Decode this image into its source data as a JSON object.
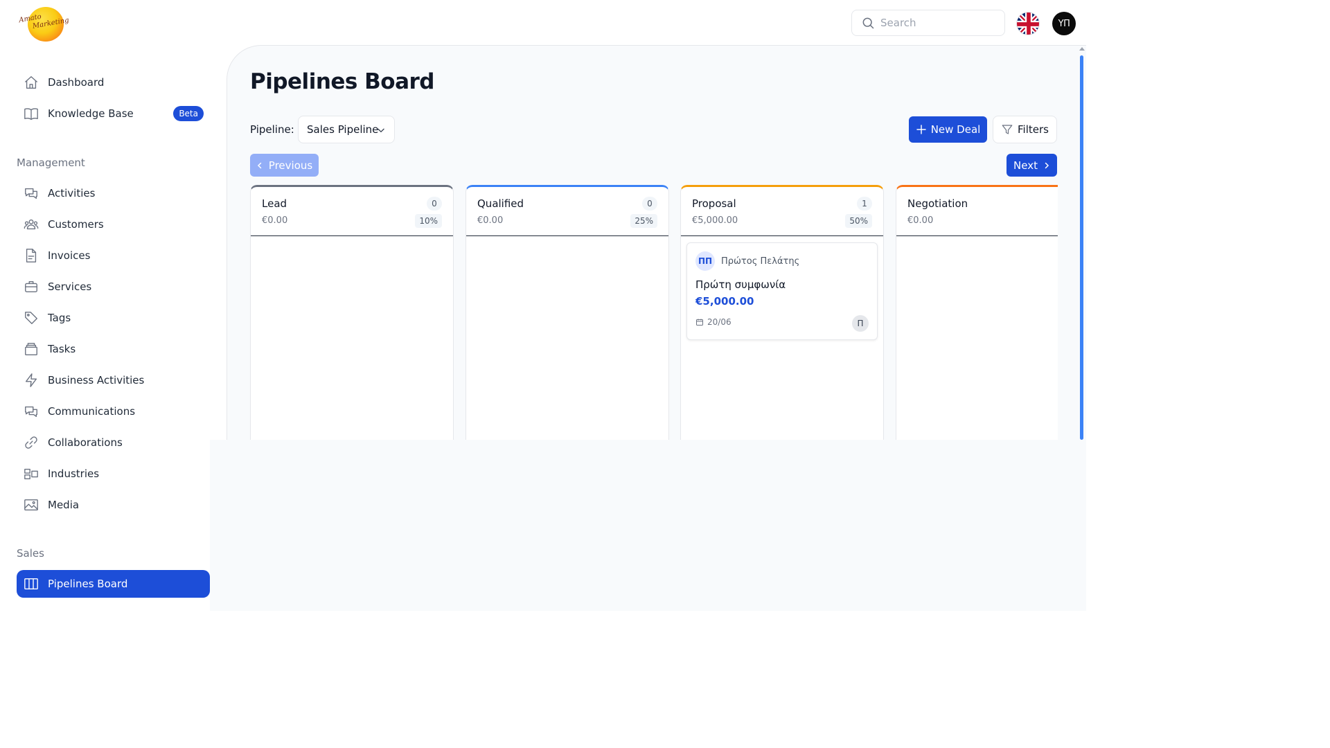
{
  "header": {
    "logo_text_line1": "Amato",
    "logo_text_line2": "Marketing",
    "search_placeholder": "Search",
    "user_initials": "ΥΠ"
  },
  "sidebar": {
    "top_items": [
      {
        "label": "Dashboard",
        "icon": "home-icon"
      },
      {
        "label": "Knowledge Base",
        "icon": "book-icon",
        "badge": "Beta"
      }
    ],
    "management_label": "Management",
    "management_items": [
      {
        "label": "Activities",
        "icon": "chat-icon"
      },
      {
        "label": "Customers",
        "icon": "users-icon"
      },
      {
        "label": "Invoices",
        "icon": "document-icon"
      },
      {
        "label": "Services",
        "icon": "briefcase-icon"
      },
      {
        "label": "Tags",
        "icon": "tag-icon"
      },
      {
        "label": "Tasks",
        "icon": "inbox-icon"
      },
      {
        "label": "Business Activities",
        "icon": "bolt-icon"
      },
      {
        "label": "Communications",
        "icon": "chat-icon"
      },
      {
        "label": "Collaborations",
        "icon": "link-icon"
      },
      {
        "label": "Industries",
        "icon": "grid-icon"
      },
      {
        "label": "Media",
        "icon": "image-icon"
      }
    ],
    "sales_label": "Sales",
    "sales_items": [
      {
        "label": "Pipelines Board",
        "icon": "columns-icon",
        "active": true
      }
    ]
  },
  "main": {
    "title": "Pipelines Board",
    "pipeline_label": "Pipeline:",
    "pipeline_value": "Sales Pipeline",
    "new_deal_label": "New Deal",
    "filters_label": "Filters",
    "previous_label": "Previous",
    "next_label": "Next",
    "columns": [
      {
        "name": "Lead",
        "amount": "€0.00",
        "count": "0",
        "percent": "10%",
        "color": "#6b7280"
      },
      {
        "name": "Qualified",
        "amount": "€0.00",
        "count": "0",
        "percent": "25%",
        "color": "#3b82f6"
      },
      {
        "name": "Proposal",
        "amount": "€5,000.00",
        "count": "1",
        "percent": "50%",
        "color": "#f59e0b"
      },
      {
        "name": "Negotiation",
        "amount": "€0.00",
        "count": "",
        "percent": "",
        "color": "#f97316"
      }
    ],
    "deal": {
      "avatar_initials": "ΠΠ",
      "customer": "Πρώτος Πελάτης",
      "title": "Πρώτη συμφωνία",
      "value": "€5,000.00",
      "date": "20/06",
      "owner_initial": "Π"
    }
  },
  "colors": {
    "accent": "#1d4ed8",
    "accent_light": "#93aef7",
    "background": "#f8fafc"
  }
}
